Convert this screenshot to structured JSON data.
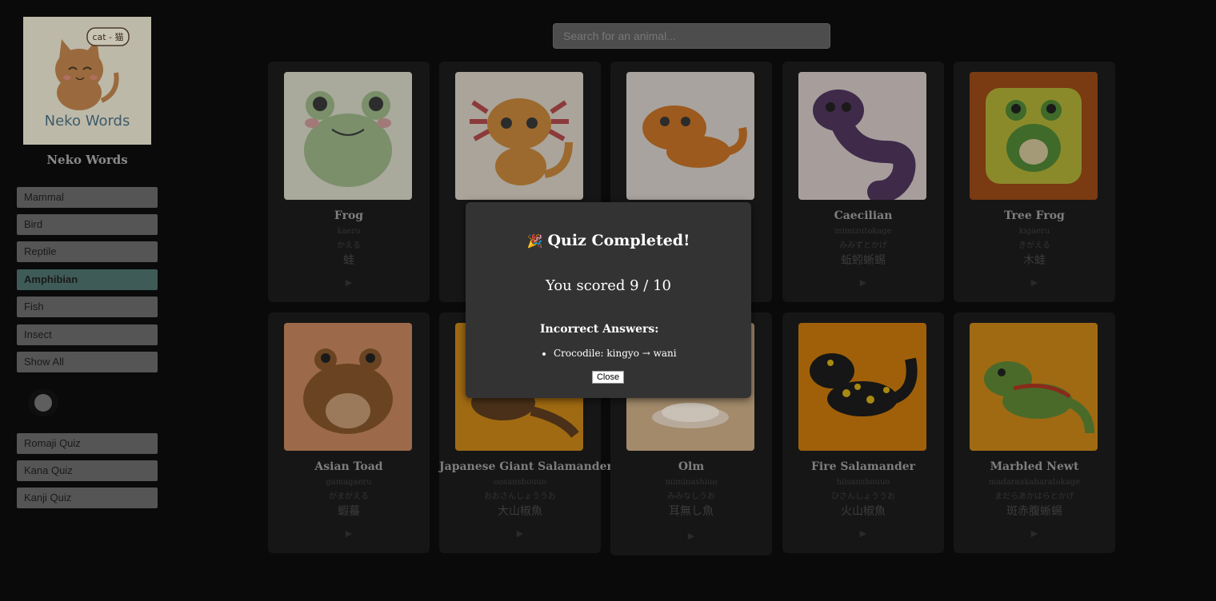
{
  "app": {
    "logo_text": "Neko Words",
    "logo_bubble": "cat - 猫",
    "title": "Neko Words"
  },
  "sidebar": {
    "categories": [
      {
        "label": "Mammal",
        "active": false
      },
      {
        "label": "Bird",
        "active": false
      },
      {
        "label": "Reptile",
        "active": false
      },
      {
        "label": "Amphibian",
        "active": true
      },
      {
        "label": "Fish",
        "active": false
      },
      {
        "label": "Insect",
        "active": false
      },
      {
        "label": "Show All",
        "active": false
      }
    ],
    "quizzes": [
      {
        "label": "Romaji Quiz"
      },
      {
        "label": "Kana Quiz"
      },
      {
        "label": "Kanji Quiz"
      }
    ]
  },
  "search": {
    "placeholder": "Search for an animal..."
  },
  "cards": [
    {
      "name": "Frog",
      "romaji": "kaeru",
      "kana": "かえる",
      "kanji": "蛙",
      "icon": "frog-icon"
    },
    {
      "name": "",
      "romaji": "",
      "kana": "",
      "kanji": "",
      "icon": "axolotl-icon"
    },
    {
      "name": "",
      "romaji": "",
      "kana": "",
      "kanji": "",
      "icon": "salamander-icon"
    },
    {
      "name": "Caecilian",
      "romaji": "mimizutokage",
      "kana": "みみずとかげ",
      "kanji": "蚯蚓蜥蜴",
      "icon": "caecilian-icon"
    },
    {
      "name": "Tree Frog",
      "romaji": "kigaeru",
      "kana": "きがえる",
      "kanji": "木蛙",
      "icon": "tree-frog-icon"
    },
    {
      "name": "Asian Toad",
      "romaji": "gamagaeru",
      "kana": "がまがえる",
      "kanji": "蝦蟇",
      "icon": "toad-icon"
    },
    {
      "name": "Japanese Giant Salamander",
      "romaji": "oosanshouuo",
      "kana": "おおさんしょううお",
      "kanji": "大山椒魚",
      "icon": "giant-salamander-icon"
    },
    {
      "name": "Olm",
      "romaji": "miminashiuo",
      "kana": "みみなしうお",
      "kanji": "耳無し魚",
      "icon": "olm-icon"
    },
    {
      "name": "Fire Salamander",
      "romaji": "hiisanshouuo",
      "kana": "ひさんしょううお",
      "kanji": "火山椒魚",
      "icon": "fire-salamander-icon"
    },
    {
      "name": "Marbled Newt",
      "romaji": "madaraakaharatokage",
      "kana": "まだらあかはらとかげ",
      "kanji": "斑赤腹蜥蜴",
      "icon": "marbled-newt-icon"
    }
  ],
  "play_symbol": "▶",
  "modal": {
    "emoji": "🎉",
    "title": "Quiz Completed!",
    "score": "You scored 9 / 10",
    "incorrect_heading": "Incorrect Answers:",
    "incorrect": [
      "Crocodile: kingyo → wani"
    ],
    "close_label": "Close"
  }
}
